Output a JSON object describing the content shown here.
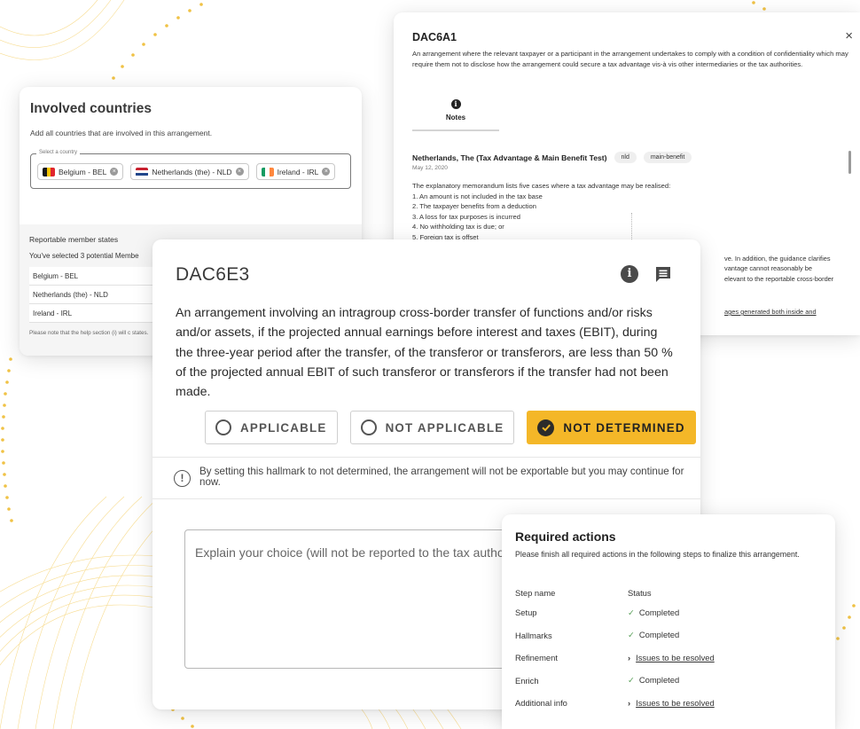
{
  "countries": {
    "title": "Involved countries",
    "subtitle": "Add all countries that are involved in this arrangement.",
    "field_label": "Select a country",
    "chips": [
      {
        "label": "Belgium - BEL"
      },
      {
        "label": "Netherlands (the) - NLD"
      },
      {
        "label": "Ireland - IRL"
      }
    ],
    "rms_title": "Reportable member states",
    "rms_sub": "You've selected 3 potential Membe",
    "rms_rows": [
      "Belgium - BEL",
      "Netherlands (the) - NLD",
      "Ireland - IRL"
    ],
    "note": "Please note that the help section (i) will c states."
  },
  "dac6a1": {
    "title": "DAC6A1",
    "close": "×",
    "description": "An arrangement where the relevant taxpayer or a participant in the arrangement undertakes to comply with a condition of confidentiality which may require them not to disclose how the arrangement could secure a tax advantage vis-à vis other intermediaries or the tax authorities.",
    "tab_icon": "i",
    "tab_label": "Notes",
    "note_title": "Netherlands, The (Tax Advantage & Main Benefit Test)",
    "tags": [
      "nld",
      "main-benefit"
    ],
    "date": "May 12, 2020",
    "lines": [
      "The explanatory memorandum lists five cases where a tax advantage may be realised:",
      "1. An amount is not included in the tax base",
      "2. The taxpayer benefits from a deduction",
      "3. A loss for tax purposes is incurred",
      "4. No withholding tax is due; or",
      "5. Foreign tax is offset"
    ],
    "right_lines": [
      "ve. In addition, the guidance clarifies",
      "vantage cannot reasonably be",
      "elevant to the reportable cross-border"
    ],
    "right_link": "ages generated both inside and"
  },
  "dac6e3": {
    "title": "DAC6E3",
    "info_icon": "i",
    "description": "An arrangement involving an intragroup cross-border transfer of functions and/or risks and/or assets, if the projected annual earnings before interest and taxes (EBIT), during the three-year period after the transfer, of the transferor or transferors, are less than 50 % of the projected annual EBIT of such transferor or transferors if the transfer had not been made.",
    "options": {
      "applicable": "APPLICABLE",
      "not_applicable": "NOT APPLICABLE",
      "not_determined": "NOT DETERMINED"
    },
    "selected": "not_determined",
    "warning_icon": "!",
    "warning": "By setting this hallmark to not determined, the arrangement will not be exportable but you may continue for now.",
    "explain_placeholder": "Explain your choice (will not be reported to the tax autho"
  },
  "required": {
    "title": "Required actions",
    "subtitle": "Please finish all required actions in the following steps to finalize this arrangement.",
    "col_step": "Step name",
    "col_status": "Status",
    "ok_icon": "✓",
    "chev_icon": "›",
    "rows": [
      {
        "step": "Setup",
        "status": "Completed"
      },
      {
        "step": "Hallmarks",
        "status": "Completed"
      },
      {
        "step": "Refinement",
        "status": "Issues to be resolved"
      },
      {
        "step": "Enrich",
        "status": "Completed"
      },
      {
        "step": "Additional info",
        "status": "Issues to be resolved"
      }
    ]
  },
  "colors": {
    "accent": "#f4b728",
    "completed": "#5aa05a",
    "decor": "#f2c037"
  }
}
